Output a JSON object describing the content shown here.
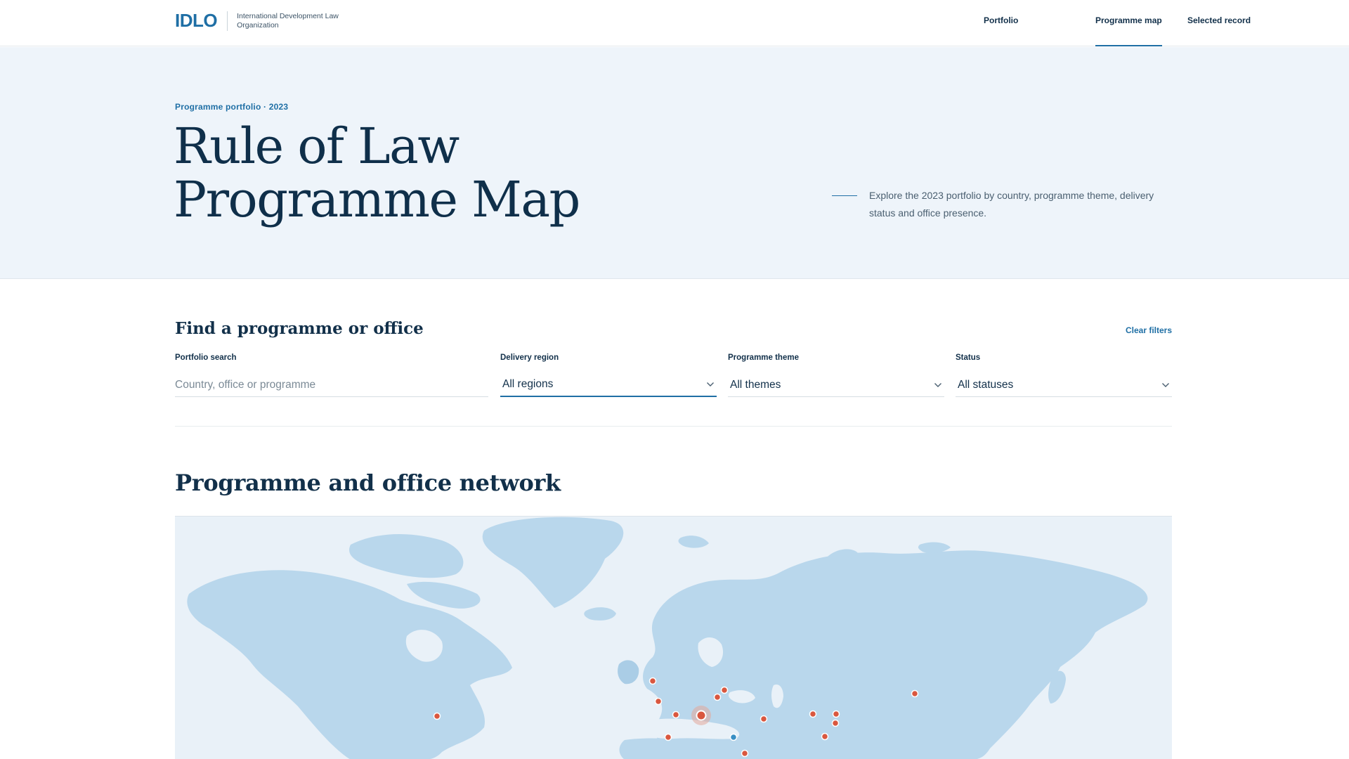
{
  "header": {
    "logo_mark": "IDLO",
    "logo_text": "International Development Law Organization",
    "nav": [
      {
        "label": "Portfolio",
        "active": false
      },
      {
        "label": "Programme map",
        "active": true
      },
      {
        "label": "Selected record",
        "active": false
      }
    ]
  },
  "hero": {
    "eyebrow": "Programme portfolio · 2023",
    "title_line1": "Rule of Law",
    "title_line2": "Programme Map",
    "description": "Explore the 2023 portfolio by country, programme theme, delivery status and office presence."
  },
  "filters": {
    "title": "Find a programme or office",
    "clear_label": "Clear filters",
    "search": {
      "label": "Portfolio search",
      "placeholder": "Country, office or programme"
    },
    "region": {
      "label": "Delivery region",
      "value": "All regions",
      "icon": "chevron-down-icon"
    },
    "theme": {
      "label": "Programme theme",
      "value": "All themes",
      "icon": "chevron-down-icon"
    },
    "status": {
      "label": "Status",
      "value": "All statuses",
      "icon": "chevron-down-icon"
    }
  },
  "network": {
    "title": "Programme and office network",
    "colors": {
      "land": "#b9d7ec",
      "ocean": "#e9f1f8",
      "programme_marker": "#d9573f",
      "office_marker": "#3a8fc4",
      "accent": "#1f6fa5"
    }
  }
}
